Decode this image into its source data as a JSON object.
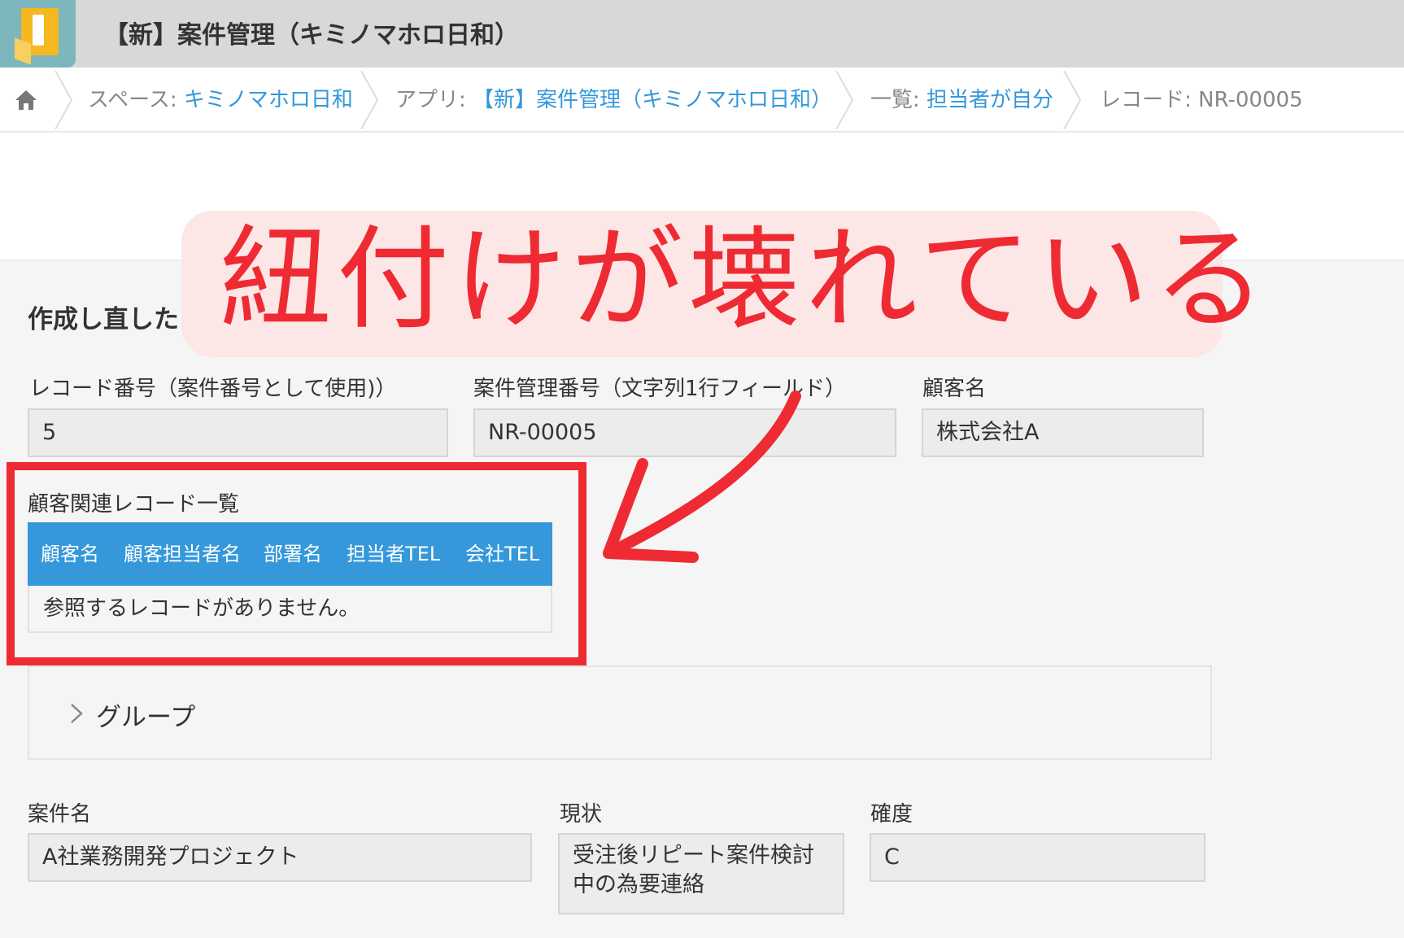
{
  "header": {
    "app_title": "【新】案件管理（キミノマホロ日和）"
  },
  "breadcrumb": {
    "space_prefix": "スペース:",
    "space_link": "キミノマホロ日和",
    "app_prefix": "アプリ:",
    "app_link": "【新】案件管理（キミノマホロ日和）",
    "list_prefix": "一覧:",
    "list_link": "担当者が自分",
    "record": "レコード: NR-00005"
  },
  "form": {
    "section_title": "作成し直した",
    "fields": {
      "record_number": {
        "label": "レコード番号（案件番号として使用)）",
        "value": "5"
      },
      "case_number": {
        "label": "案件管理番号（文字列1行フィールド）",
        "value": "NR-00005"
      },
      "customer_name": {
        "label": "顧客名",
        "value": "株式会社A"
      },
      "case_name": {
        "label": "案件名",
        "value": "A社業務開発プロジェクト"
      },
      "status": {
        "label": "現状",
        "value_line1": "受注後リピート案件検討",
        "value_line2": "中の為要連絡"
      },
      "certainty": {
        "label": "確度",
        "value": "C"
      }
    },
    "related_records": {
      "label": "顧客関連レコード一覧",
      "columns": [
        "顧客名",
        "顧客担当者名",
        "部署名",
        "担当者TEL",
        "会社TEL"
      ],
      "empty_message": "参照するレコードがありません。"
    },
    "group": {
      "label": "グループ"
    }
  },
  "annotation": {
    "text": "紐付けが壊れている",
    "color": "#ee2b32"
  },
  "colors": {
    "link": "#3498db",
    "table_header": "#3498db",
    "annotation_bg": "#fde6e6"
  },
  "icons": [
    "app-icon",
    "home-icon",
    "chevron-right-icon",
    "arrow-icon"
  ]
}
